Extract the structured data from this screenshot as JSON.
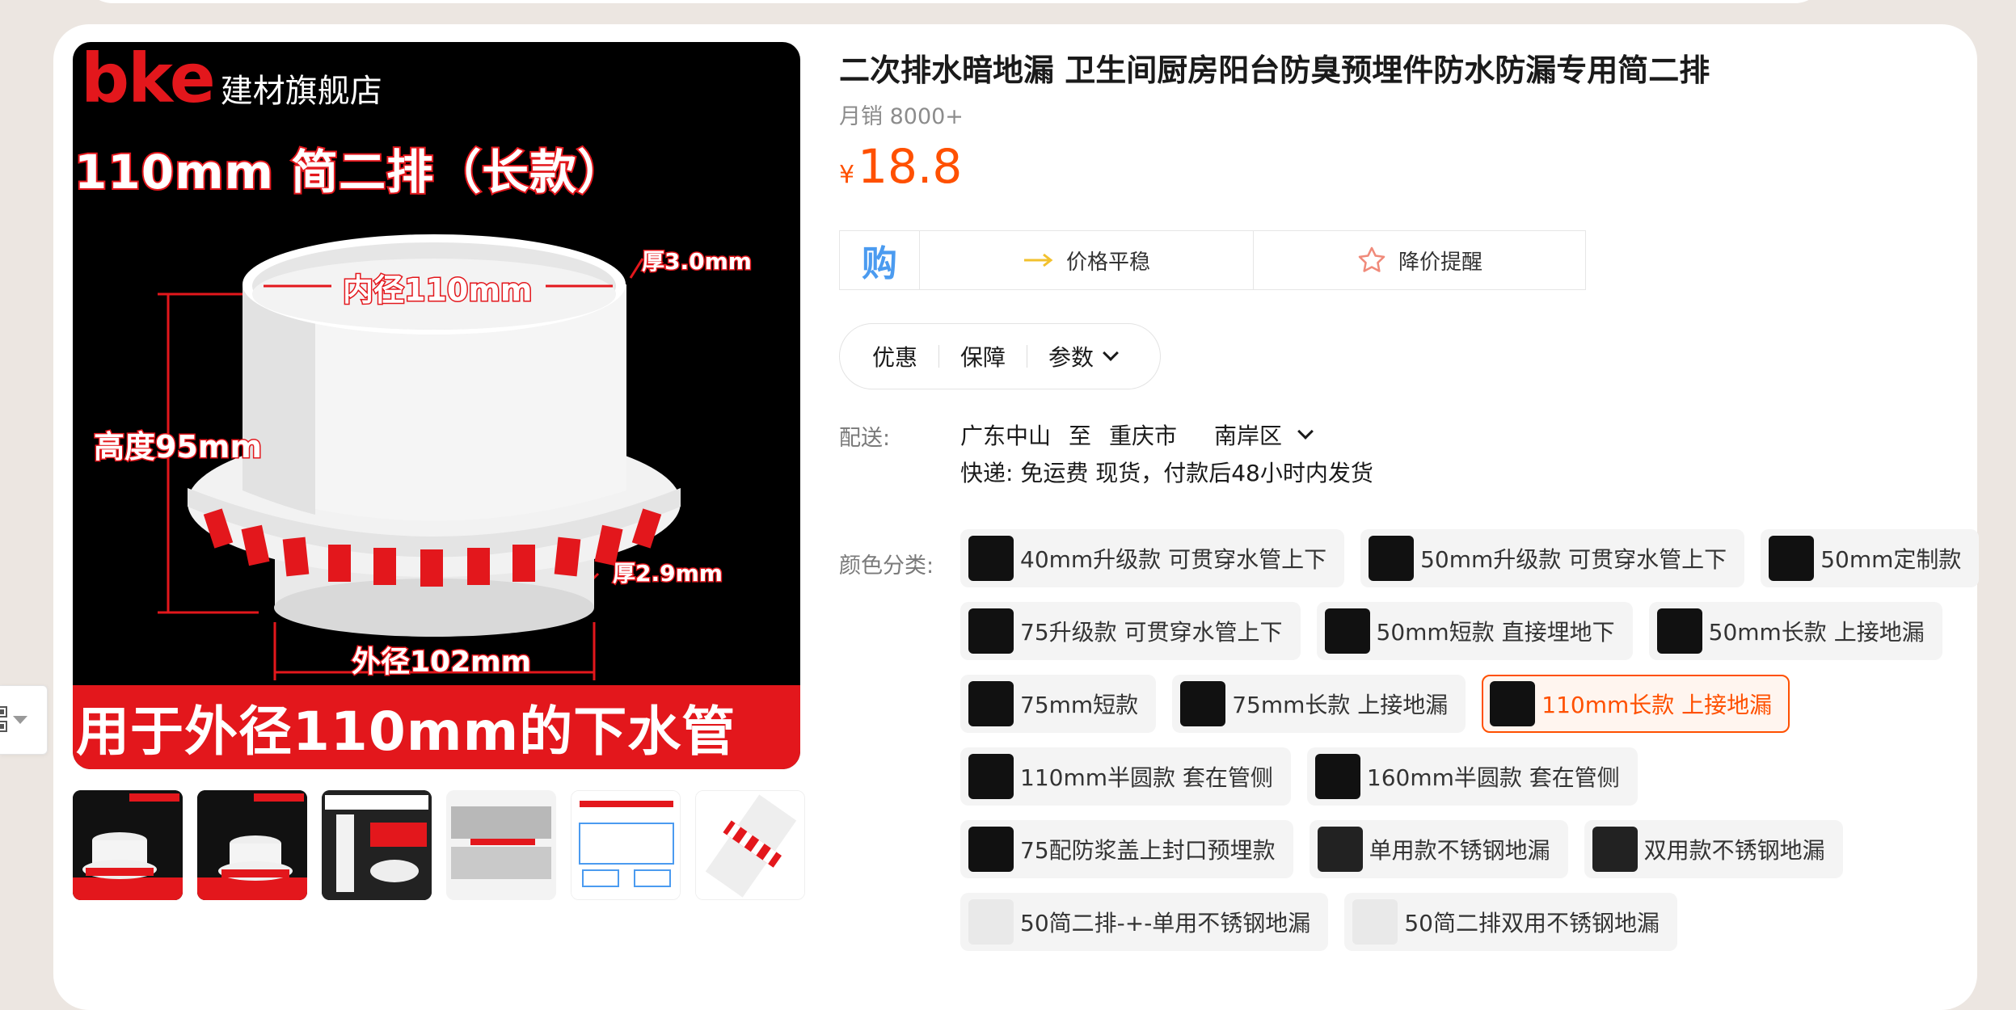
{
  "product": {
    "title": "二次排水暗地漏 卫生间厨房阳台防臭预埋件防水防漏专用简二排",
    "sales": "月销 8000+",
    "currency": "¥",
    "price": "18.8"
  },
  "main_image": {
    "brand_logo": "bke",
    "brand_store": "建材旗舰店",
    "headline": "110mm  简二排（长款）",
    "dim_inner": "内径110mm",
    "dim_thick_top": "厚3.0mm",
    "dim_height": "高度95mm",
    "dim_thick_bottom": "厚2.9mm",
    "dim_outer": "外径102mm",
    "bottom_banner": "用于外径110mm的下水管"
  },
  "price_box": {
    "buy_glyph": "购",
    "stable_label": "价格平稳",
    "remind_label": "降价提醒"
  },
  "tabs": [
    "优惠",
    "保障",
    "参数"
  ],
  "delivery": {
    "label": "配送:",
    "from": "广东中山",
    "to_word": "至",
    "city": "重庆市",
    "district": "南岸区",
    "shipping": "快递: 免运费  现货，付款后48小时内发货"
  },
  "sku": {
    "label": "颜色分类:",
    "rows": [
      [
        "40mm升级款 可贯穿水管上下",
        "50mm升级款 可贯穿水管上下",
        "50mm定制款"
      ],
      [
        "75升级款 可贯穿水管上下",
        "50mm短款 直接埋地下",
        "50mm长款 上接地漏"
      ],
      [
        "75mm短款",
        "75mm长款 上接地漏",
        "110mm长款 上接地漏"
      ],
      [
        "110mm半圆款 套在管侧",
        "160mm半圆款 套在管侧"
      ],
      [
        "75配防浆盖上封口预埋款",
        "单用款不锈钢地漏",
        "双用款不锈钢地漏"
      ],
      [
        "50简二排-+-单用不锈钢地漏",
        "50简二排双用不锈钢地漏"
      ]
    ],
    "selected": "110mm长款 上接地漏"
  },
  "colors": {
    "accent": "#ff5000",
    "brand_red": "#e3171c",
    "buy_blue": "#4b9bf0"
  }
}
